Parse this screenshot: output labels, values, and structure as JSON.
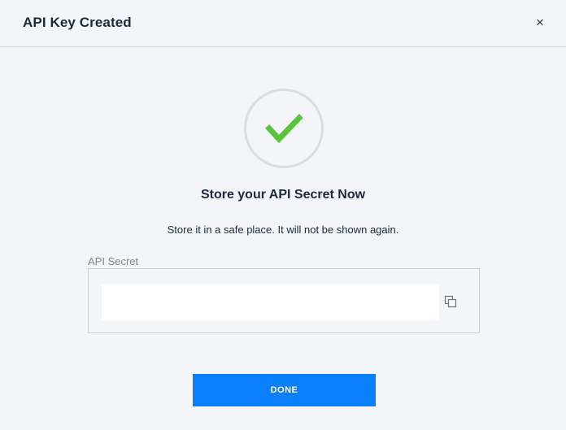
{
  "dialog": {
    "title": "API Key Created",
    "close_label": "×"
  },
  "success": {
    "icon": "checkmark-icon",
    "icon_color": "#5ac43c",
    "heading": "Store your API Secret Now",
    "message": "Store it in a safe place. It will not be shown again."
  },
  "secret": {
    "label": "API Secret",
    "value": "",
    "copy_icon": "copy-icon"
  },
  "actions": {
    "done_label": "DONE",
    "done_color": "#0a80ff"
  }
}
